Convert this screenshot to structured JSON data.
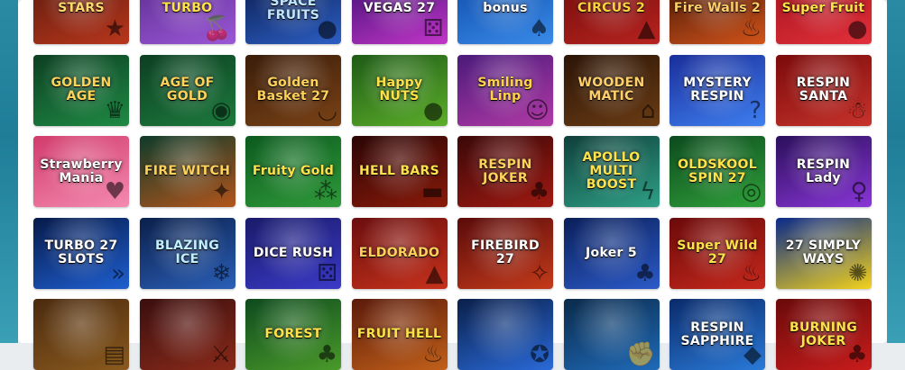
{
  "games": [
    {
      "title": "STARS",
      "icon": "star-icon",
      "colors": [
        "#5a1a0e",
        "#b8361c"
      ],
      "text": "#ffd86a"
    },
    {
      "title": "TURBO",
      "icon": "cherry-icon",
      "colors": [
        "#5a2b8e",
        "#9b57d6"
      ],
      "text": "#ffe24a"
    },
    {
      "title": "SPACE FRUITS",
      "icon": "planet-icon",
      "colors": [
        "#0a1a4a",
        "#2c5fc4"
      ],
      "text": "#bfe6ff"
    },
    {
      "title": "VEGAS 27",
      "icon": "dice-icon",
      "colors": [
        "#3b0e72",
        "#c236c8"
      ],
      "text": "#ffffff"
    },
    {
      "title": "bonus",
      "icon": "jack-icon",
      "colors": [
        "#0d4aa8",
        "#3a8be8"
      ],
      "text": "#ffffff"
    },
    {
      "title": "CIRCUS 2",
      "icon": "tent-icon",
      "colors": [
        "#6e0b0b",
        "#b7231f"
      ],
      "text": "#ffd23a"
    },
    {
      "title": "Fire Walls 2",
      "icon": "flame-icon",
      "colors": [
        "#3b1205",
        "#d3541a"
      ],
      "text": "#ffcf6a"
    },
    {
      "title": "Super Fruit",
      "icon": "lemon-icon",
      "colors": [
        "#a0121c",
        "#e2303b"
      ],
      "text": "#ffe34a"
    },
    {
      "title": "GOLDEN AGE",
      "icon": "crown-icon",
      "colors": [
        "#0c3f22",
        "#1f8a44"
      ],
      "text": "#ffd25a"
    },
    {
      "title": "AGE OF GOLD",
      "icon": "coin-icon",
      "colors": [
        "#0c3f22",
        "#1d7a3c"
      ],
      "text": "#ffd25a"
    },
    {
      "title": "Golden Basket 27",
      "icon": "basket-icon",
      "colors": [
        "#3a1d0a",
        "#7a4216"
      ],
      "text": "#ffd25a"
    },
    {
      "title": "Happy NUTS",
      "icon": "nut-icon",
      "colors": [
        "#1e5a16",
        "#5cae2a"
      ],
      "text": "#ffe24a"
    },
    {
      "title": "Smiling Linp",
      "icon": "face-icon",
      "colors": [
        "#4a1a7a",
        "#b23aa6"
      ],
      "text": "#ffd24a"
    },
    {
      "title": "WOODEN MATIC",
      "icon": "cabin-icon",
      "colors": [
        "#2b1406",
        "#6a3c14"
      ],
      "text": "#ffcf6a"
    },
    {
      "title": "MYSTERY RESPIN",
      "icon": "question-icon",
      "colors": [
        "#1a2e9a",
        "#3f7ff0"
      ],
      "text": "#ffffff"
    },
    {
      "title": "RESPIN SANTA",
      "icon": "santa-icon",
      "colors": [
        "#7a0a0a",
        "#c7332c"
      ],
      "text": "#ffffff"
    },
    {
      "title": "Strawberry Mania",
      "icon": "strawberry-icon",
      "colors": [
        "#d13b6c",
        "#f48ab0"
      ],
      "text": "#ffffff"
    },
    {
      "title": "FIRE WITCH",
      "icon": "witch-icon",
      "colors": [
        "#0e3b2a",
        "#b3551c"
      ],
      "text": "#ffd25a"
    },
    {
      "title": "Fruity Gold",
      "icon": "grapes-icon",
      "colors": [
        "#0c5a1e",
        "#2f9a3a"
      ],
      "text": "#ffe24a"
    },
    {
      "title": "HELL BARS",
      "icon": "bar-icon",
      "colors": [
        "#2a0505",
        "#8a1a0a"
      ],
      "text": "#ffe24a"
    },
    {
      "title": "RESPIN JOKER",
      "icon": "joker-icon",
      "colors": [
        "#3a0808",
        "#a01a12"
      ],
      "text": "#ffd25a"
    },
    {
      "title": "APOLLO MULTI BOOST",
      "icon": "bolt-icon",
      "colors": [
        "#0e3f3a",
        "#2fa086"
      ],
      "text": "#ffe24a"
    },
    {
      "title": "OLDSKOOL SPIN 27",
      "icon": "reel-icon",
      "colors": [
        "#0d4a1e",
        "#2fa03a"
      ],
      "text": "#ffe24a"
    },
    {
      "title": "RESPIN Lady",
      "icon": "lady-icon",
      "colors": [
        "#2a0f5a",
        "#8a36d8"
      ],
      "text": "#ffffff"
    },
    {
      "title": "TURBO 27 SLOTS",
      "icon": "speed-icon",
      "colors": [
        "#061a4a",
        "#1f5fd0"
      ],
      "text": "#ffffff"
    },
    {
      "title": "BLAZING ICE",
      "icon": "snowflake-icon",
      "colors": [
        "#0b1f4a",
        "#2a5fb8"
      ],
      "text": "#bff0ff"
    },
    {
      "title": "DICE RUSH",
      "icon": "dice-icon",
      "colors": [
        "#1a1a6a",
        "#3a3ac8"
      ],
      "text": "#ffffff"
    },
    {
      "title": "ELDORADO",
      "icon": "temple-icon",
      "colors": [
        "#6a0e0e",
        "#c8321c"
      ],
      "text": "#ffd25a"
    },
    {
      "title": "FIREBIRD 27",
      "icon": "bird-icon",
      "colors": [
        "#5a0b0b",
        "#c43a1a"
      ],
      "text": "#ffffff"
    },
    {
      "title": "Joker 5",
      "icon": "joker-icon",
      "colors": [
        "#0a1f5a",
        "#2c5ac8"
      ],
      "text": "#ffffff"
    },
    {
      "title": "Super Wild 27",
      "icon": "flame-icon",
      "colors": [
        "#6a0a0a",
        "#c7281c"
      ],
      "text": "#ffe24a"
    },
    {
      "title": "27 SIMPLY WAYS",
      "icon": "sunburst-icon",
      "colors": [
        "#0a2a8a",
        "#f3d21c"
      ],
      "text": "#ffffff"
    },
    {
      "title": "",
      "icon": "book-icon",
      "colors": [
        "#4a2a0e",
        "#8a5a1e"
      ],
      "text": "#ffd25a"
    },
    {
      "title": "",
      "icon": "warrior-icon",
      "colors": [
        "#3a0e0e",
        "#8a2a1a"
      ],
      "text": "#ffd25a"
    },
    {
      "title": "FOREST",
      "icon": "tree-icon",
      "colors": [
        "#0e4a1e",
        "#4a9a2a"
      ],
      "text": "#ffe24a"
    },
    {
      "title": "FRUIT HELL",
      "icon": "flame-icon",
      "colors": [
        "#5a1a0a",
        "#c2601a"
      ],
      "text": "#ffe24a"
    },
    {
      "title": "",
      "icon": "hero-icon",
      "colors": [
        "#0a1f4a",
        "#2a6ad8"
      ],
      "text": "#ffffff"
    },
    {
      "title": "",
      "icon": "fighter-icon",
      "colors": [
        "#0a2a4a",
        "#1f6ab8"
      ],
      "text": "#ffffff"
    },
    {
      "title": "RESPIN SAPPHIRE",
      "icon": "gem-icon",
      "colors": [
        "#0a2a6a",
        "#2a7ad8"
      ],
      "text": "#ffffff"
    },
    {
      "title": "BURNING JOKER",
      "icon": "joker-icon",
      "colors": [
        "#6a0a0a",
        "#c81c1c"
      ],
      "text": "#ffe24a"
    }
  ]
}
